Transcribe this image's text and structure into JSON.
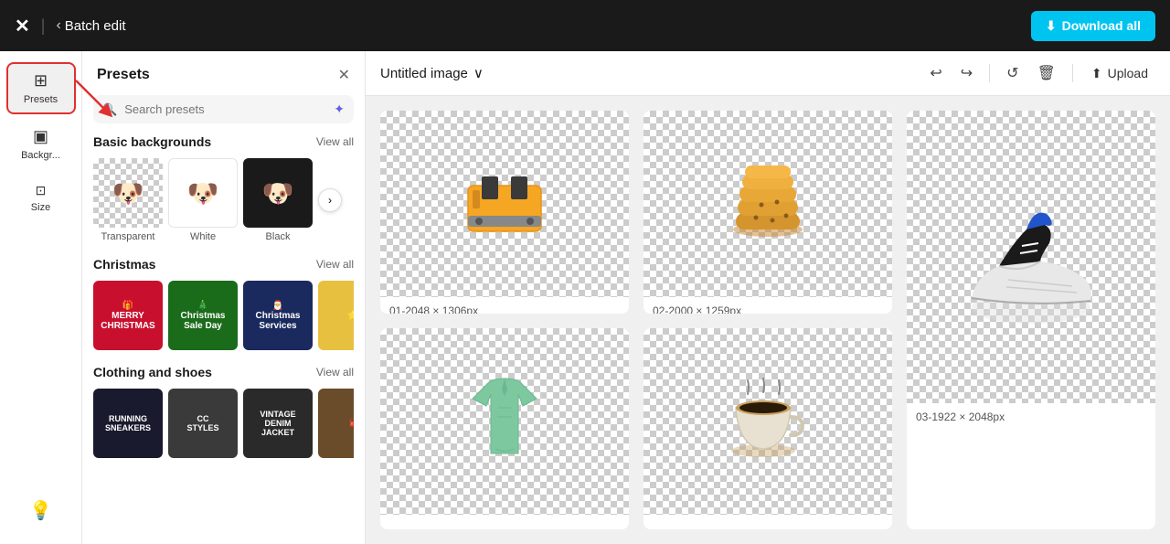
{
  "header": {
    "logo": "✕",
    "back_label": "‹",
    "page_title": "Batch edit",
    "download_btn": "Download all",
    "download_icon": "⬇"
  },
  "sidebar": {
    "items": [
      {
        "id": "presets",
        "label": "Presets",
        "icon": "⊞",
        "active": true
      },
      {
        "id": "backgrounds",
        "label": "Backgr...",
        "icon": "▣"
      },
      {
        "id": "size",
        "label": "Size",
        "icon": "⊡"
      }
    ],
    "bottom_icon": "💡"
  },
  "presets_panel": {
    "title": "Presets",
    "close_label": "✕",
    "search_placeholder": "Search presets",
    "search_icon": "🔍",
    "magic_icon": "✦",
    "sections": [
      {
        "id": "basic-backgrounds",
        "title": "Basic backgrounds",
        "view_all": "View all",
        "items": [
          {
            "id": "transparent",
            "label": "Transparent",
            "style": "transparent"
          },
          {
            "id": "white",
            "label": "White",
            "style": "white"
          },
          {
            "id": "black",
            "label": "Black",
            "style": "black"
          }
        ]
      },
      {
        "id": "christmas",
        "title": "Christmas",
        "view_all": "View all",
        "items": [
          {
            "id": "christmas-1",
            "label": "",
            "style": "christmas-1"
          },
          {
            "id": "christmas-2",
            "label": "",
            "style": "christmas-2"
          },
          {
            "id": "christmas-3",
            "label": "",
            "style": "christmas-3"
          },
          {
            "id": "christmas-4",
            "label": "",
            "style": "christmas-4"
          }
        ]
      },
      {
        "id": "clothing-shoes",
        "title": "Clothing and shoes",
        "view_all": "View all",
        "items": [
          {
            "id": "clothing-1",
            "label": "",
            "style": "clothing-1"
          },
          {
            "id": "clothing-2",
            "label": "",
            "style": "clothing-2"
          },
          {
            "id": "clothing-3",
            "label": "",
            "style": "clothing-3"
          },
          {
            "id": "clothing-4",
            "label": "",
            "style": "clothing-4"
          }
        ]
      }
    ]
  },
  "content": {
    "image_title": "Untitled image",
    "dropdown_icon": "∨",
    "toolbar": {
      "undo": "↩",
      "redo": "↪",
      "loop": "↺",
      "trash": "🗑",
      "upload": "Upload",
      "upload_icon": "⬆"
    },
    "images": [
      {
        "id": "01",
        "label": "01-2048 × 1306px",
        "product": "🍞",
        "size": "wide"
      },
      {
        "id": "02",
        "label": "02-2000 × 1259px",
        "product": "🍪",
        "size": "wide"
      },
      {
        "id": "03",
        "label": "03-1922 × 2048px",
        "product": "👟",
        "size": "tall"
      },
      {
        "id": "04",
        "label": "",
        "product": "👕",
        "size": "wide"
      },
      {
        "id": "05",
        "label": "",
        "product": "☕",
        "size": "wide"
      }
    ]
  }
}
